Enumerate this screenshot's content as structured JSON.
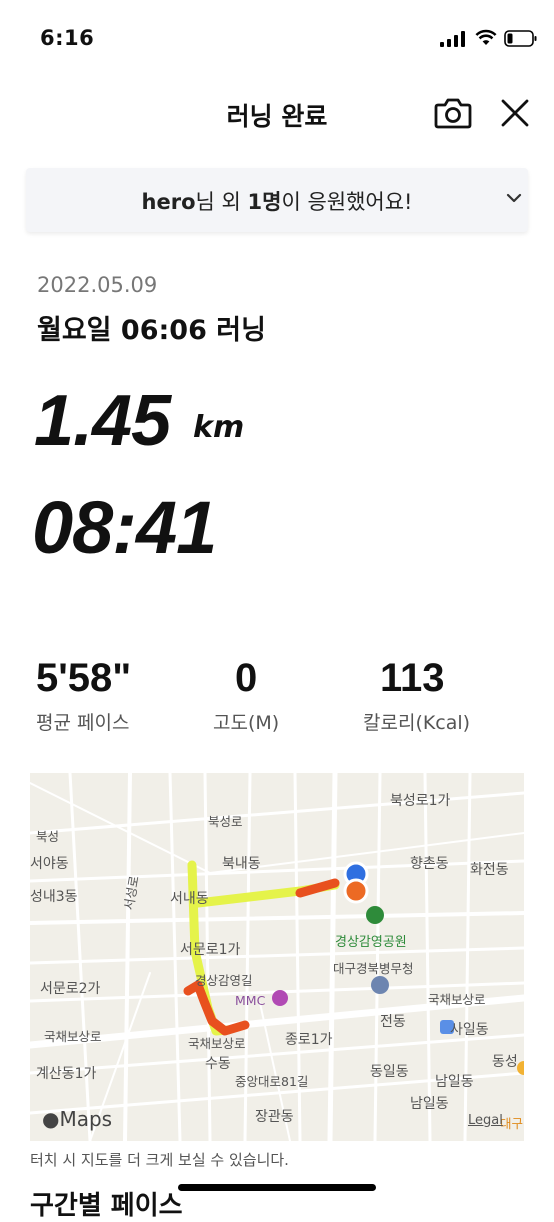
{
  "status_bar": {
    "time": "6:16"
  },
  "header": {
    "title": "러닝 완료"
  },
  "cheer": {
    "name": "hero",
    "text_a": "님 외 ",
    "count": "1명",
    "text_b": "이 응원했어요!"
  },
  "run": {
    "date": "2022.05.09",
    "name": "월요일 06:06 러닝",
    "distance": "1.45",
    "distance_unit": "km",
    "duration": "08:41"
  },
  "stats": [
    {
      "value": "5'58\"",
      "label": "평균 페이스"
    },
    {
      "value": "0",
      "label": "고도(M)"
    },
    {
      "value": "113",
      "label": "칼로리(Kcal)"
    }
  ],
  "map": {
    "labels": {
      "bukseongro1ga": "북성로1가",
      "bukseongro": "북성로",
      "bukseong": "북성",
      "seoyadong": "서야동",
      "seongnae3dong": "성내3동",
      "buknaedong": "북내동",
      "hyangchondong": "향촌동",
      "hwajeondong": "화전동",
      "seonaedong": "서내동",
      "seoseongro": "서성로",
      "park": "경상감영공원",
      "daegu_office": "대구경북병무청",
      "seomunro1ga": "서문로1가",
      "gyeongsang_gamyeong_gil": "경상감영길",
      "seomunro2ga": "서문로2가",
      "mmc": "MMC",
      "gukchae_bosang_ro_r": "국채보상로",
      "gukchae_bosang_ro_l": "국채보상로",
      "gukchae_bosang_ro_c": "국채보상로",
      "jeondong": "전동",
      "sailldong": "사일동",
      "jongro1ga": "종로1가",
      "sudong": "수동",
      "dongildong": "동일동",
      "dongseong": "동성",
      "gyesandong1ga": "계산동1가",
      "jungangdaero81gil": "중앙대로81길",
      "namildong_a": "남일동",
      "namildong_b": "남일동",
      "janggwandong": "장관동",
      "daegu": "대구"
    },
    "maps_brand": "Maps",
    "legal": "Legal"
  },
  "hint": "터치 시 지도를 더 크게 보실 수 있습니다.",
  "next_section_heading": "구간별 페이스",
  "colors": {
    "route_fast": "#e5f34a",
    "route_slow": "#e8501e",
    "start_pin": "#2f6fe0",
    "end_pin": "#ec6a24",
    "park": "#2e8b3a"
  }
}
